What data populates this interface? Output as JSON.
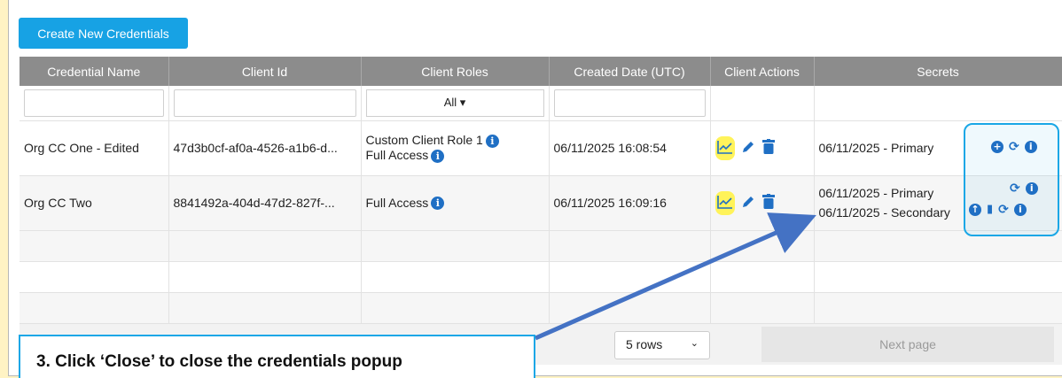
{
  "toolbar": {
    "create_label": "Create New Credentials"
  },
  "table": {
    "headers": [
      "Credential Name",
      "Client Id",
      "Client Roles",
      "Created Date (UTC)",
      "Client Actions",
      "Secrets"
    ],
    "roles_filter": "All",
    "rows": [
      {
        "name": "Org CC One - Edited",
        "client_id": "47d3b0cf-af0a-4526-a1b6-d...",
        "roles": [
          "Custom Client Role 1",
          "Full Access"
        ],
        "created": "06/11/2025 16:08:54",
        "secrets": [
          "06/11/2025 - Primary"
        ]
      },
      {
        "name": "Org CC Two",
        "client_id": "8841492a-404d-47d2-827f-...",
        "roles": [
          "Full Access"
        ],
        "created": "06/11/2025 16:09:16",
        "secrets": [
          "06/11/2025 - Primary",
          "06/11/2025 - Secondary"
        ]
      }
    ]
  },
  "pager": {
    "rows_label": "5 rows",
    "next_label": "Next page"
  },
  "callout": {
    "text": "3. Click ‘Close’ to close the credentials popup"
  },
  "colors": {
    "accent": "#17a2e4",
    "header": "#8c8c8c",
    "icon": "#1f6fc4",
    "highlight": "#fff35a"
  }
}
